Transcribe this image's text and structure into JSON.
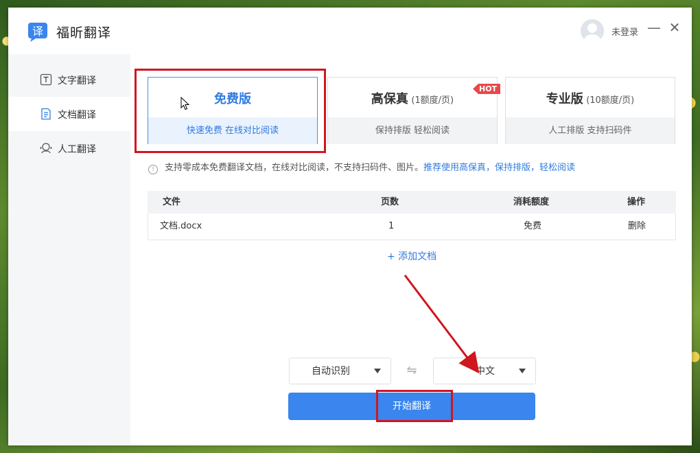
{
  "app": {
    "title": "福昕翻译",
    "logo_char": "译"
  },
  "header": {
    "login_text": "未登录",
    "minimize_symbol": "—",
    "close_symbol": "✕"
  },
  "sidebar": {
    "items": [
      {
        "label": "文字翻译",
        "icon": "text-icon",
        "active": false
      },
      {
        "label": "文档翻译",
        "icon": "document-icon",
        "active": true
      },
      {
        "label": "人工翻译",
        "icon": "human-icon",
        "active": false
      }
    ]
  },
  "plans": [
    {
      "title": "免费版",
      "sub": "",
      "desc": "快速免费 在线对比阅读",
      "selected": true
    },
    {
      "title": "高保真",
      "sub": "(1额度/页)",
      "desc": "保持排版 轻松阅读",
      "badge": "HOT"
    },
    {
      "title": "专业版",
      "sub": "(10额度/页)",
      "desc": "人工排版 支持扫码件"
    }
  ],
  "notice": {
    "icon": "!",
    "text": "支持零成本免费翻译文档，在线对比阅读，不支持扫码件、图片。",
    "link": "推荐使用高保真，保持排版，轻松阅读"
  },
  "table": {
    "headers": [
      "文件",
      "页数",
      "消耗额度",
      "操作"
    ],
    "rows": [
      {
        "file": "文档.docx",
        "pages": "1",
        "cost": "免费",
        "action": "删除"
      }
    ]
  },
  "add_doc": "+ 添加文档",
  "source_lang": "自动识别",
  "target_lang": "中文",
  "swap_symbol": "⇋",
  "start_button": "开始翻译",
  "colors": {
    "accent": "#3a85ee",
    "highlight": "#d0161e",
    "hot": "#e8484a"
  }
}
